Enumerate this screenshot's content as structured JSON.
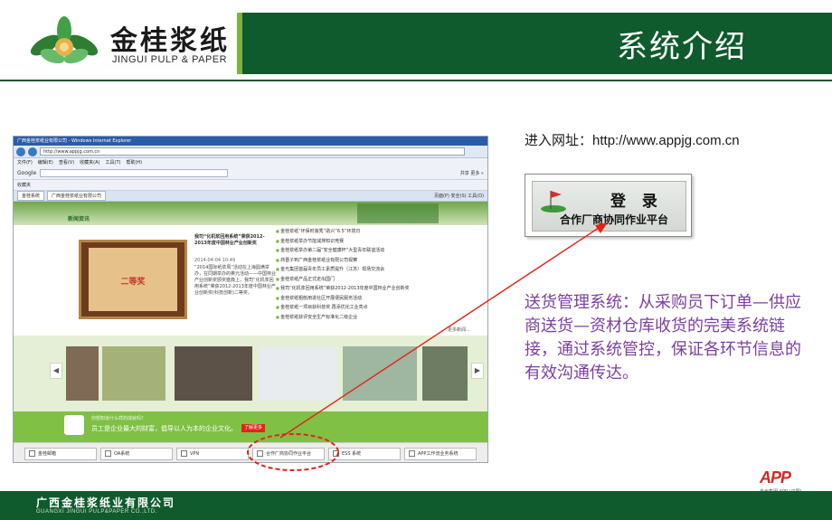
{
  "header": {
    "logo_cn": "金桂浆纸",
    "logo_en": "JINGUI PULP & PAPER",
    "title": "系统介绍"
  },
  "browser": {
    "window_title": "广西金桂浆纸业有限公司 - Windows Internet Explorer",
    "url": "http://www.appjg.com.cn",
    "menu": [
      "文件(F)",
      "编辑(E)",
      "查看(V)",
      "收藏夹(A)",
      "工具(T)",
      "帮助(H)"
    ],
    "google_label": "Google",
    "google_right": "共享 更多 »",
    "favorites_label": "收藏夹",
    "tabs": [
      "金桂系统",
      "广西金桂浆纸业有限公司"
    ],
    "tools": "页面(P) 安全(S) 工具(O)"
  },
  "site": {
    "news_title": "新闻资讯",
    "certificate_text": "二等奖",
    "feature_headline": "我司“化机浆回用系统”荣获2012-2013年度中国林业产业创新奖",
    "feature_date": "2014-04-04 10:49",
    "feature_body": "“2014国际纸浆周”活动在上海圆满举办，在同期举办的奥元活动——中国林业产业创新奖颁奖盛典上，我司“化机浆回用系统”荣获2012-2013年度中国林业产业创新奖(科技创新)二等奖。",
    "news_items": [
      "金桂浆纸“环保时装秀”助兴“6.5”环境日",
      "金桂浆纸举办节能减排知识竞赛",
      "金桂浆纸举办第二届“安全健康杯”大型青年联谊活动",
      "商晋子到广西金桂浆纸业有限公司视察",
      "金光集团首届青年员工素质提升（江苏）现场交流会",
      "金桂浆纸产品正式走出国门",
      "我司“化机浆回用系统”荣获2012-2013年度中国林业产业创新奖",
      "金桂浆纸粗刨用进社区开展便民服务活动",
      "金桂浆纸一项目获科技奖 再添优化工业亮点",
      "金桂浆纸获评安全生产标准化二级企业"
    ],
    "more": "更多新闻...",
    "slogan_question": "你想知道什么样的成就吗？",
    "slogan_main": "员工是企业最大的财富，倡导以人为本的企业文化。",
    "slogan_button": "了解更多",
    "portal_buttons": [
      "金桂邮箱",
      "OA系统",
      "VPN",
      "合作厂商协同作业平台",
      "ESS 系统",
      "APP工作流业务系统"
    ]
  },
  "panel": {
    "url_prefix": "进入网址：",
    "url": "http://www.appjg.com.cn",
    "login_title": "登 录",
    "login_sub": "合作厂商协同作业平台",
    "description": "送货管理系统：从采购员下订单—供应商送货—资材仓库收货的完美系统链接，通过系统管控，保证各环节信息的有效沟通传达。"
  },
  "footer": {
    "app_mark": "APP",
    "app_caption": "金光集团 APP (中国)",
    "company_cn": "广西金桂浆纸业有限公司",
    "company_en": "GUANGXI JINGUI PULP&PAPER CO.,LTD."
  },
  "colors": {
    "brand_green": "#0f5b2d",
    "accent_green": "#7fc045",
    "description_purple": "#7b3fa1",
    "annotation_red": "#e2231a"
  }
}
